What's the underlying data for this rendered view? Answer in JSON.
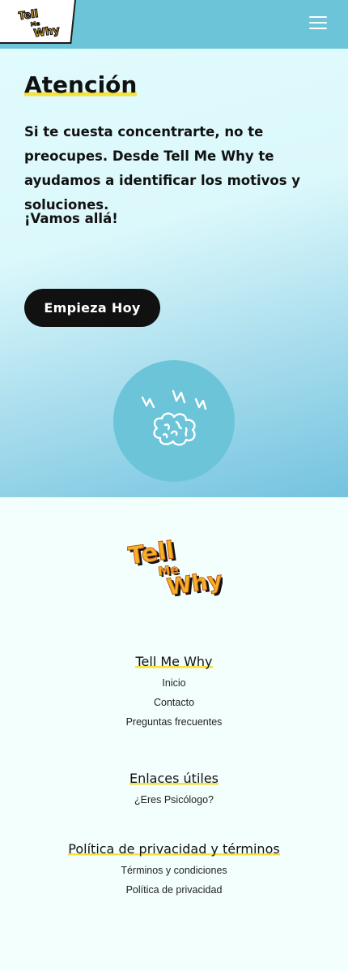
{
  "header": {
    "logo_alt": "Tell Me Why",
    "menu_icon": "hamburger-menu-icon"
  },
  "hero": {
    "title": "Atención",
    "body": "Si te cuesta concentrarte, no te preocupes. Desde Tell Me Why te ayudamos a identificar los motivos y soluciones.",
    "tagline": "¡Vamos allá!",
    "cta_label": "Empieza Hoy",
    "illustration_icon": "brain-icon",
    "colors": {
      "circle": "#6cc4d9",
      "button": "#111111",
      "highlight": "#f6e23c"
    }
  },
  "footer": {
    "logo_text": [
      "Tell",
      "Me",
      "Why"
    ],
    "sections": [
      {
        "heading": "Tell Me Why",
        "links": [
          "Inicio",
          "Contacto",
          "Preguntas frecuentes"
        ]
      },
      {
        "heading": "Enlaces útiles",
        "links": [
          "¿Eres Psicólogo?"
        ]
      },
      {
        "heading": "Política de privacidad y términos",
        "links": [
          "Términos y condiciones",
          "Política de privacidad"
        ]
      }
    ]
  }
}
